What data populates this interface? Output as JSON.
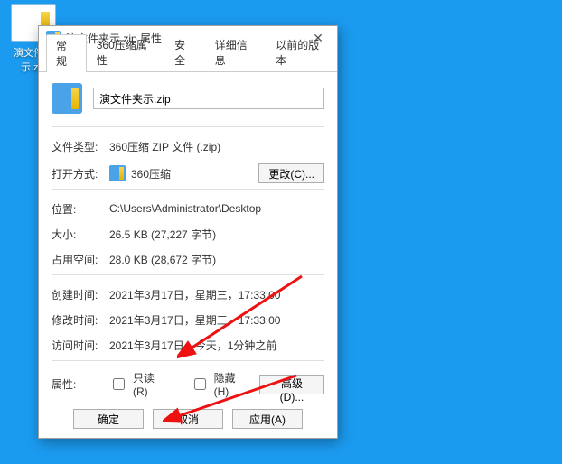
{
  "desktop": {
    "icon_label": "演文件夹示.zip"
  },
  "dialog": {
    "title": "演文件夹示.zip 属性",
    "tabs": [
      "常规",
      "360压缩属性",
      "安全",
      "详细信息",
      "以前的版本"
    ],
    "filename": "演文件夹示.zip",
    "filetype_lbl": "文件类型:",
    "filetype_val": "360压缩 ZIP 文件 (.zip)",
    "openwith_lbl": "打开方式:",
    "openwith_val": "360压缩",
    "change_btn": "更改(C)...",
    "location_lbl": "位置:",
    "location_val": "C:\\Users\\Administrator\\Desktop",
    "size_lbl": "大小:",
    "size_val": "26.5 KB (27,227 字节)",
    "diskSize_lbl": "占用空间:",
    "diskSize_val": "28.0 KB (28,672 字节)",
    "created_lbl": "创建时间:",
    "created_val": "2021年3月17日，星期三，17:33:00",
    "modified_lbl": "修改时间:",
    "modified_val": "2021年3月17日，星期三，17:33:00",
    "accessed_lbl": "访问时间:",
    "accessed_val": "2021年3月17日，今天，1分钟之前",
    "attributes_lbl": "属性:",
    "readonly_lbl": "只读(R)",
    "hidden_lbl": "隐藏(H)",
    "advanced_btn": "高级(D)...",
    "ok_btn": "确定",
    "cancel_btn": "取消",
    "apply_btn": "应用(A)"
  }
}
